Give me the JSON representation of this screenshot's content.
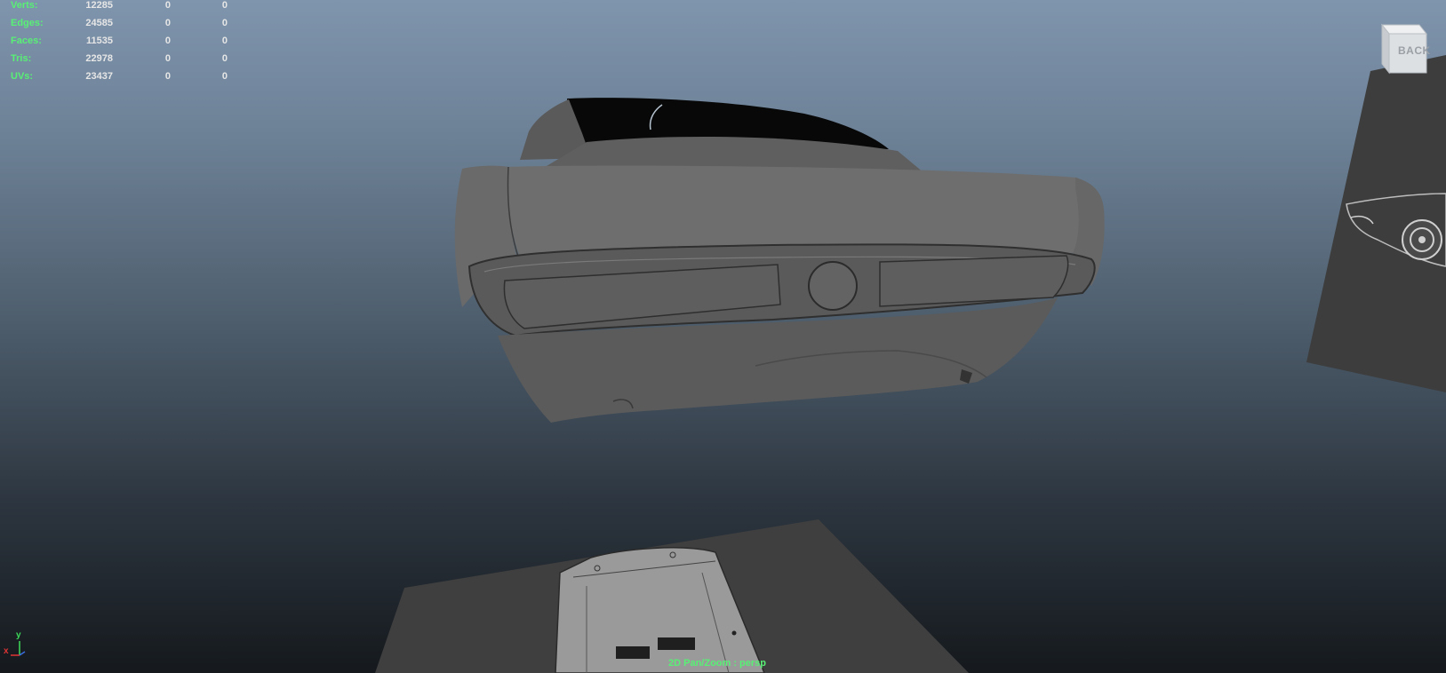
{
  "hud": {
    "rows": [
      {
        "label": "Verts:",
        "v1": "12285",
        "v2": "0",
        "v3": "0"
      },
      {
        "label": "Edges:",
        "v1": "24585",
        "v2": "0",
        "v3": "0"
      },
      {
        "label": "Faces:",
        "v1": "11535",
        "v2": "0",
        "v3": "0"
      },
      {
        "label": "Tris:",
        "v1": "22978",
        "v2": "0",
        "v3": "0"
      },
      {
        "label": "UVs:",
        "v1": "23437",
        "v2": "0",
        "v3": "0"
      }
    ]
  },
  "viewcube": {
    "label": "BACK"
  },
  "axis": {
    "y": "y",
    "x": "x"
  },
  "status": {
    "text": "2D Pan/Zoom : persp"
  },
  "colors": {
    "hud_label": "#58f075",
    "hud_value": "#e6e6e6",
    "model_gray": "#646464",
    "image_plane": "#3f3f3f"
  },
  "icons": {
    "viewcube": "view-cube-icon",
    "axis": "axis-gizmo-icon"
  }
}
